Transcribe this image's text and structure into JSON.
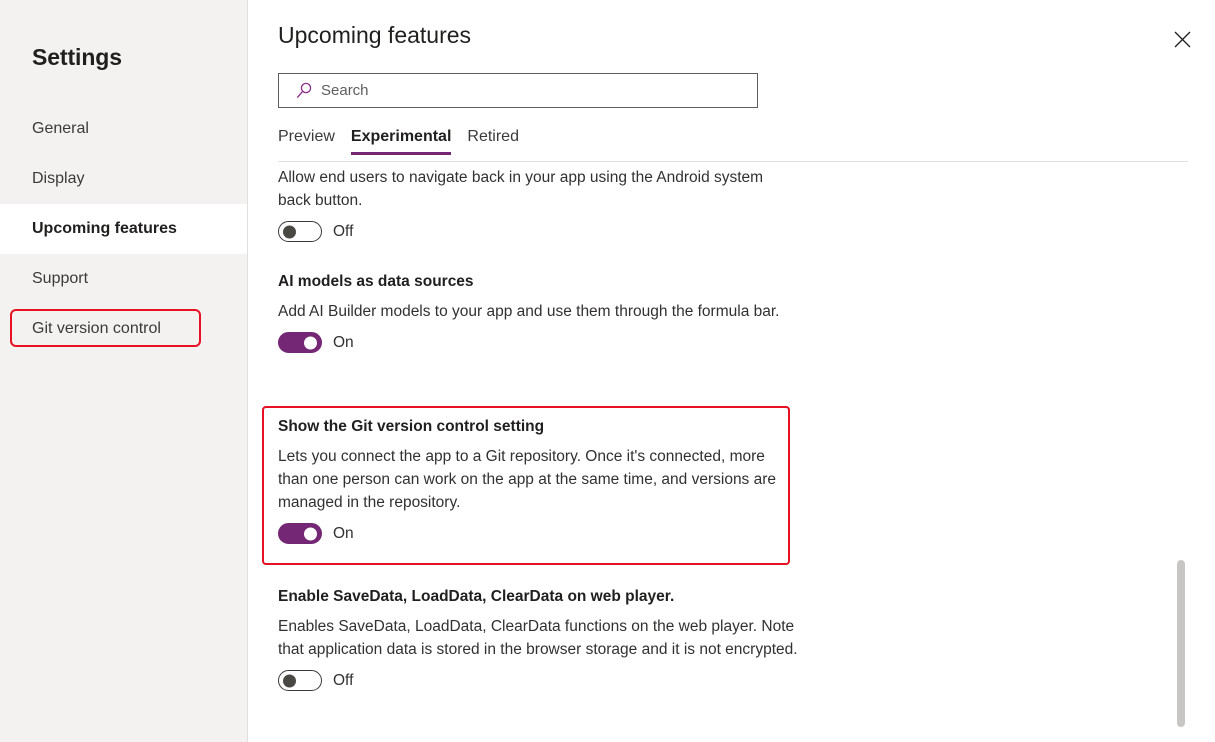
{
  "sidebar": {
    "title": "Settings",
    "items": [
      {
        "label": "General",
        "selected": false,
        "outlined": false
      },
      {
        "label": "Display",
        "selected": false,
        "outlined": false
      },
      {
        "label": "Upcoming features",
        "selected": true,
        "outlined": false
      },
      {
        "label": "Support",
        "selected": false,
        "outlined": false
      },
      {
        "label": "Git version control",
        "selected": false,
        "outlined": true
      }
    ]
  },
  "header": {
    "title": "Upcoming features",
    "close_icon": "close-icon"
  },
  "search": {
    "icon": "search-icon",
    "placeholder": "Search",
    "value": ""
  },
  "tabs": [
    {
      "label": "Preview",
      "active": false
    },
    {
      "label": "Experimental",
      "active": true
    },
    {
      "label": "Retired",
      "active": false
    }
  ],
  "features": [
    {
      "title": "",
      "description": "Allow end users to navigate back in your app using the Android system back button.",
      "toggle_state": "Off",
      "toggle_on": false,
      "highlighted": false
    },
    {
      "title": "AI models as data sources",
      "description": "Add AI Builder models to your app and use them through the formula bar.",
      "toggle_state": "On",
      "toggle_on": true,
      "highlighted": false
    },
    {
      "title": "Show the Git version control setting",
      "description": "Lets you connect the app to a Git repository. Once it's connected, more than one person can work on the app at the same time, and versions are managed in the repository.",
      "toggle_state": "On",
      "toggle_on": true,
      "highlighted": true
    },
    {
      "title": "Enable SaveData, LoadData, ClearData on web player.",
      "description": "Enables SaveData, LoadData, ClearData functions on the web player. Note that application data is stored in the browser storage and it is not encrypted.",
      "toggle_state": "Off",
      "toggle_on": false,
      "highlighted": false
    }
  ],
  "colors": {
    "accent": "#742774",
    "highlight_outline": "#e81123",
    "sidebar_bg": "#f3f2f1",
    "scrollbar_thumb": "#c8c6c4"
  }
}
